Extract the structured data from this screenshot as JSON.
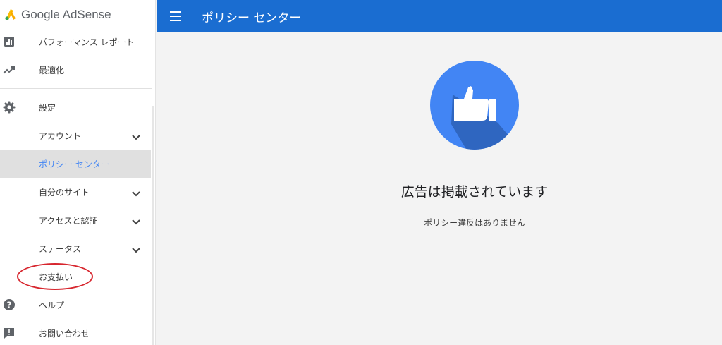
{
  "brand": {
    "name": "Google AdSense"
  },
  "header": {
    "menu_icon": "menu-icon",
    "title": "ポリシー センター",
    "color": "#1a6dd1"
  },
  "sidebar": {
    "items": [
      {
        "label": "パフォーマンス レポート",
        "icon": "bar-chart-icon"
      },
      {
        "label": "最適化",
        "icon": "trending-up-icon"
      },
      {
        "label": "設定",
        "icon": "gear-icon"
      },
      {
        "label": "アカウント",
        "expandable": true
      },
      {
        "label": "ポリシー センター",
        "active": true
      },
      {
        "label": "自分のサイト",
        "expandable": true
      },
      {
        "label": "アクセスと認証",
        "expandable": true
      },
      {
        "label": "ステータス",
        "expandable": true
      },
      {
        "label": "お支払い",
        "highlighted": true
      },
      {
        "label": "ヘルプ",
        "icon": "help-circle-icon"
      },
      {
        "label": "お問い合わせ",
        "icon": "feedback-icon"
      }
    ],
    "active_color": "#4285f4",
    "highlight_color": "#d7262e"
  },
  "main": {
    "status_icon": "thumbs-up-icon",
    "status_title": "広告は掲載されています",
    "status_subtitle": "ポリシー違反はありません",
    "icon_color": "#4285f4"
  }
}
